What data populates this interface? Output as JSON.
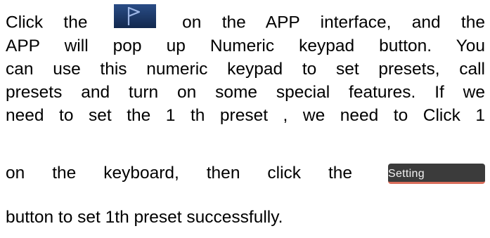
{
  "document": {
    "lines": [
      [
        "Click the",
        "on the APP interface, and the"
      ],
      [
        "APP will pop up Numeric keypad button. You"
      ],
      [
        "can use this numeric keypad to set presets, call"
      ],
      [
        "presets and turn on some special features. If we"
      ],
      [
        "need to set the 1 th preset , we need to Click 1"
      ],
      [
        "on the keyboard, then click the"
      ],
      [
        "button to set 1th preset successfully."
      ]
    ]
  },
  "icons": {
    "flag": "flag-icon"
  },
  "buttons": {
    "setting": "Setting"
  },
  "colors": {
    "text": "#000000",
    "button_background": "#3b3b3b",
    "button_text": "#f3f3f3",
    "button_accent": "#d96d5b",
    "icon_background": "#1f3a6b",
    "icon_stroke": "#9db6e5"
  }
}
